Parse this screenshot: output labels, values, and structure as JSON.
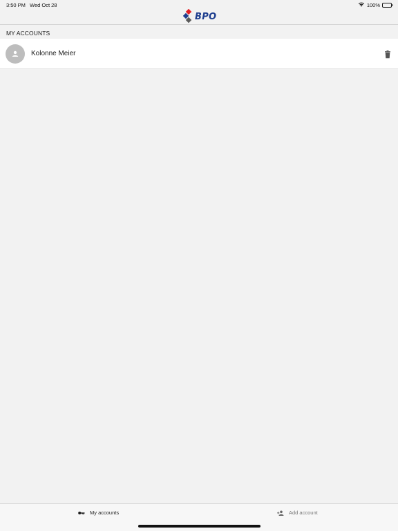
{
  "status_bar": {
    "time": "3:50 PM",
    "date": "Wed Oct 28",
    "battery": "100%"
  },
  "header": {
    "logo_text": "BPO",
    "logo_colors": [
      "#e31e24",
      "#1f3f8f",
      "#5a5a5a"
    ]
  },
  "section": {
    "title": "MY ACCOUNTS"
  },
  "accounts": [
    {
      "name": "Kolonne Meier",
      "avatar_icon": "person-icon",
      "action_icon": "trash-icon"
    }
  ],
  "tab_bar": {
    "tabs": [
      {
        "label": "My accounts",
        "icon": "key-icon",
        "selected": true
      },
      {
        "label": "Add account",
        "icon": "add-person-icon",
        "selected": false
      }
    ]
  },
  "colors": {
    "background": "#f2f2f2",
    "row_background": "#ffffff",
    "avatar": "#bdbdbd",
    "inactive_tab": "#777777"
  }
}
